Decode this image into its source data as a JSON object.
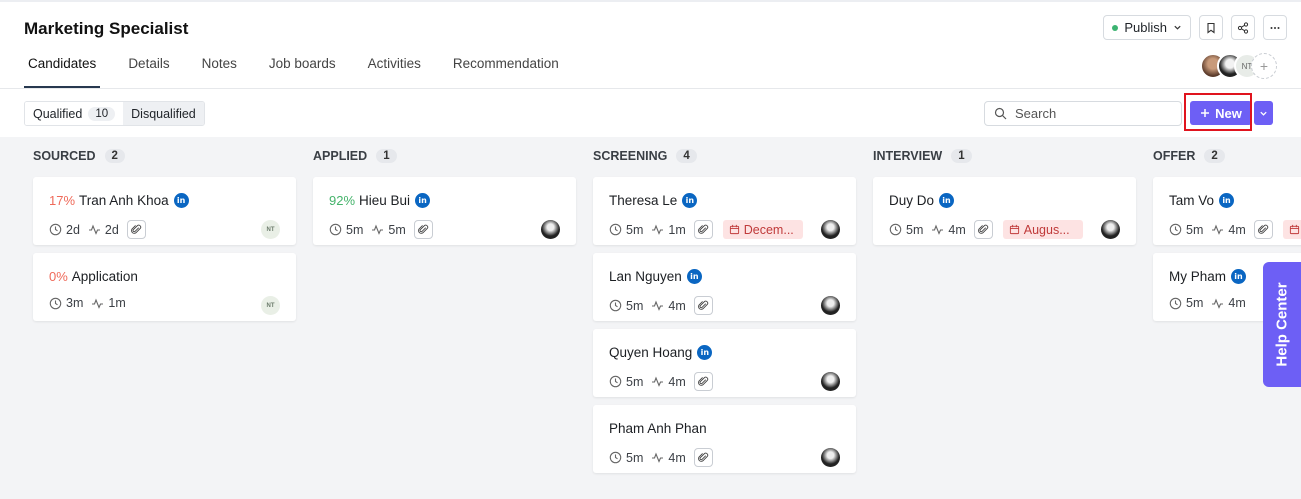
{
  "header": {
    "title": "Marketing Specialist",
    "publish_label": "Publish",
    "tabs": [
      "Candidates",
      "Details",
      "Notes",
      "Job boards",
      "Activities",
      "Recommendation"
    ],
    "avatar_initials": "NT",
    "add_avatar": "+"
  },
  "toolbar": {
    "qualified_label": "Qualified",
    "qualified_count": "10",
    "disqualified_label": "Disqualified",
    "search_placeholder": "Search",
    "new_label": "New"
  },
  "columns": [
    {
      "name": "SOURCED",
      "count": "2",
      "cards": [
        {
          "percent": "17%",
          "percent_color": "red",
          "name": "Tran Anh Khoa",
          "linkedin": true,
          "time": "2d",
          "activity": "2d",
          "attachment": true,
          "date_tag": null,
          "owner": "NT"
        },
        {
          "percent": "0%",
          "percent_color": "red",
          "name": "Application",
          "linkedin": false,
          "time": "3m",
          "activity": "1m",
          "attachment": false,
          "date_tag": null,
          "owner": "NT"
        }
      ]
    },
    {
      "name": "APPLIED",
      "count": "1",
      "cards": [
        {
          "percent": "92%",
          "percent_color": "green",
          "name": "Hieu Bui",
          "linkedin": true,
          "time": "5m",
          "activity": "5m",
          "attachment": true,
          "date_tag": null,
          "owner": "photo"
        }
      ]
    },
    {
      "name": "SCREENING",
      "count": "4",
      "cards": [
        {
          "percent": "",
          "name": "Theresa Le",
          "linkedin": true,
          "time": "5m",
          "activity": "1m",
          "attachment": true,
          "date_tag": "Decem...",
          "owner": "photo"
        },
        {
          "percent": "",
          "name": "Lan Nguyen",
          "linkedin": true,
          "time": "5m",
          "activity": "4m",
          "attachment": true,
          "date_tag": null,
          "owner": "photo"
        },
        {
          "percent": "",
          "name": "Quyen Hoang",
          "linkedin": true,
          "time": "5m",
          "activity": "4m",
          "attachment": true,
          "date_tag": null,
          "owner": "photo"
        },
        {
          "percent": "",
          "name": "Pham Anh Phan",
          "linkedin": false,
          "time": "5m",
          "activity": "4m",
          "attachment": true,
          "date_tag": null,
          "owner": "photo"
        }
      ]
    },
    {
      "name": "INTERVIEW",
      "count": "1",
      "cards": [
        {
          "percent": "",
          "name": "Duy Do",
          "linkedin": true,
          "time": "5m",
          "activity": "4m",
          "attachment": true,
          "date_tag": "Augus...",
          "owner": "photo"
        }
      ]
    },
    {
      "name": "OFFER",
      "count": "2",
      "cards": [
        {
          "percent": "",
          "name": "Tam Vo",
          "linkedin": true,
          "time": "5m",
          "activity": "4m",
          "attachment": true,
          "date_tag": "",
          "owner": "photo"
        },
        {
          "percent": "",
          "name": "My Pham",
          "linkedin": true,
          "time": "5m",
          "activity": "4m",
          "attachment": false,
          "date_tag": null,
          "owner": "photo"
        }
      ]
    }
  ],
  "help_center_label": "Help Center",
  "colors": {
    "accent": "#6d5ff5",
    "linkedin": "#0a66c2",
    "highlight": "#e0141e"
  }
}
